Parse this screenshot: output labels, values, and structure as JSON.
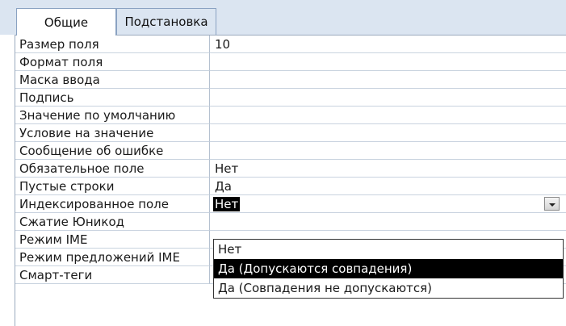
{
  "tabs": [
    {
      "label": "Общие",
      "active": true
    },
    {
      "label": "Подстановка",
      "active": false
    }
  ],
  "rows": [
    {
      "label": "Размер поля",
      "value": "10"
    },
    {
      "label": "Формат поля",
      "value": ""
    },
    {
      "label": "Маска ввода",
      "value": ""
    },
    {
      "label": "Подпись",
      "value": ""
    },
    {
      "label": "Значение по умолчанию",
      "value": ""
    },
    {
      "label": "Условие на значение",
      "value": ""
    },
    {
      "label": "Сообщение об ошибке",
      "value": ""
    },
    {
      "label": "Обязательное поле",
      "value": "Нет"
    },
    {
      "label": "Пустые строки",
      "value": "Да"
    },
    {
      "label": "Индексированное поле",
      "value": "Нет"
    },
    {
      "label": "Сжатие Юникод",
      "value": ""
    },
    {
      "label": "Режим IME",
      "value": ""
    },
    {
      "label": "Режим предложений IME",
      "value": ""
    },
    {
      "label": "Смарт-теги",
      "value": ""
    }
  ],
  "dropdown": {
    "options": [
      "Нет",
      "Да (Допускаются совпадения)",
      "Да (Совпадения не допускаются)"
    ],
    "highlighted_index": 1
  },
  "icons": {
    "dropdown_button": "chevron-down-icon"
  }
}
